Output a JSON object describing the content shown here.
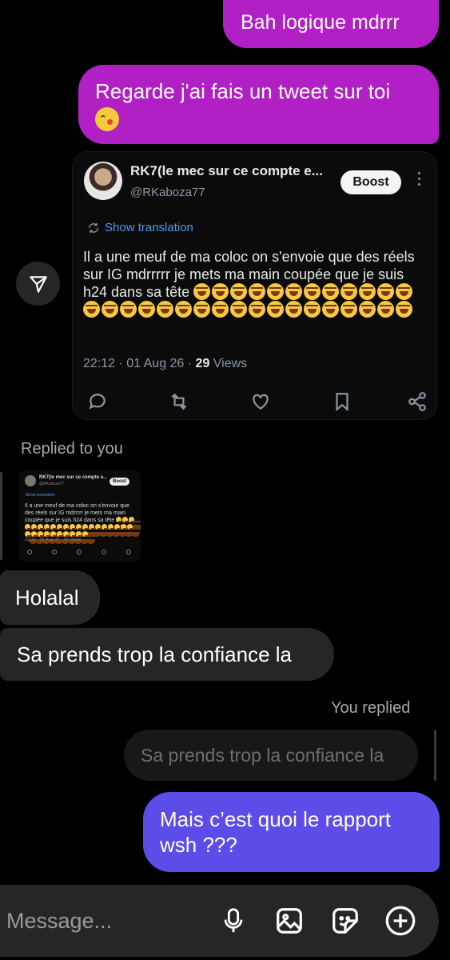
{
  "messages": {
    "top_sent": "Bah logique mdrrr",
    "regarde_sent": "Regarde j'ai fais un tweet sur toi",
    "holalal": "Holalal",
    "sa_prends": "Sa prends trop la confiance la",
    "mais_sent": "Mais c’est quoi le rapport wsh ???"
  },
  "tweet": {
    "name": "RK7(le mec sur ce compte e...",
    "handle": "@RKaboza77",
    "boost_label": "Boost",
    "show_translation": "Show translation",
    "text": "Il a une meuf de ma coloc on s'envoie que des réels sur IG mdrrrrr je mets ma main coupée que je suis h24 dans sa tête",
    "laugh_emoji_count": 30,
    "time_date": "22:12 · 01 Aug 26 · ",
    "views_count": "29",
    "views_label": " Views"
  },
  "reply_context": {
    "replied_label": "Replied to you",
    "thumb_name": "RK7(le mec sur ce compte e...",
    "thumb_handle": "@RKaboza77",
    "thumb_boost": "Boost",
    "thumb_translation": "Show translation",
    "thumb_text": "Il a une meuf de ma coloc on s'envoie que des réels sur IG mdrrrrr je mets ma main coupée que je suis h24 dans sa tête",
    "thumb_meta": "22:12 · 01 Aug 26 · 29 Views"
  },
  "you_replied": {
    "label": "You replied",
    "quoted": "Sa prends trop la confiance la"
  },
  "composer": {
    "placeholder": "Message..."
  },
  "icons": {
    "share": "send-icon",
    "mic": "microphone-icon",
    "gallery": "gallery-icon",
    "sticker": "sticker-icon",
    "add": "plus-circle-icon",
    "reply": "reply-icon",
    "retweet": "retweet-icon",
    "like": "heart-icon",
    "bookmark": "bookmark-icon",
    "share_tweet": "share-icon",
    "translate": "translate-icon"
  },
  "colors": {
    "sent_purple": "#b020c4",
    "sent_blue": "#5c4ce8",
    "received_grey": "#262626",
    "link_blue": "#4f9ae6"
  }
}
